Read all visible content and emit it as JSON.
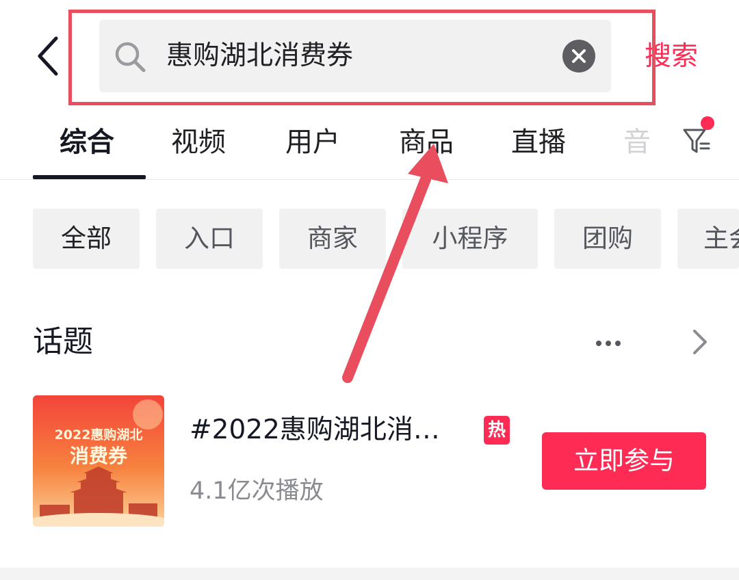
{
  "header": {
    "search_value": "惠购湖北消费券",
    "search_button": "搜索"
  },
  "tabs": [
    "综合",
    "视频",
    "用户",
    "商品",
    "直播",
    "音"
  ],
  "chips": [
    "全部",
    "入口",
    "商家",
    "小程序",
    "团购",
    "主会"
  ],
  "section": {
    "title": "话题"
  },
  "topic": {
    "title": "#2022惠购湖北消…",
    "hot_badge": "热",
    "play_count": "4.1亿次播放",
    "join_button": "立即参与",
    "thumbnail_line1": "2022惠购湖北",
    "thumbnail_line2": "消费券"
  },
  "colors": {
    "accent": "#fe2c55",
    "annotation": "#e84e5e"
  },
  "icons": {
    "back": "back-arrow-icon",
    "search": "search-icon",
    "clear": "clear-icon",
    "filter": "filter-icon",
    "more": "more-dots-icon",
    "chevron": "chevron-right-icon"
  }
}
